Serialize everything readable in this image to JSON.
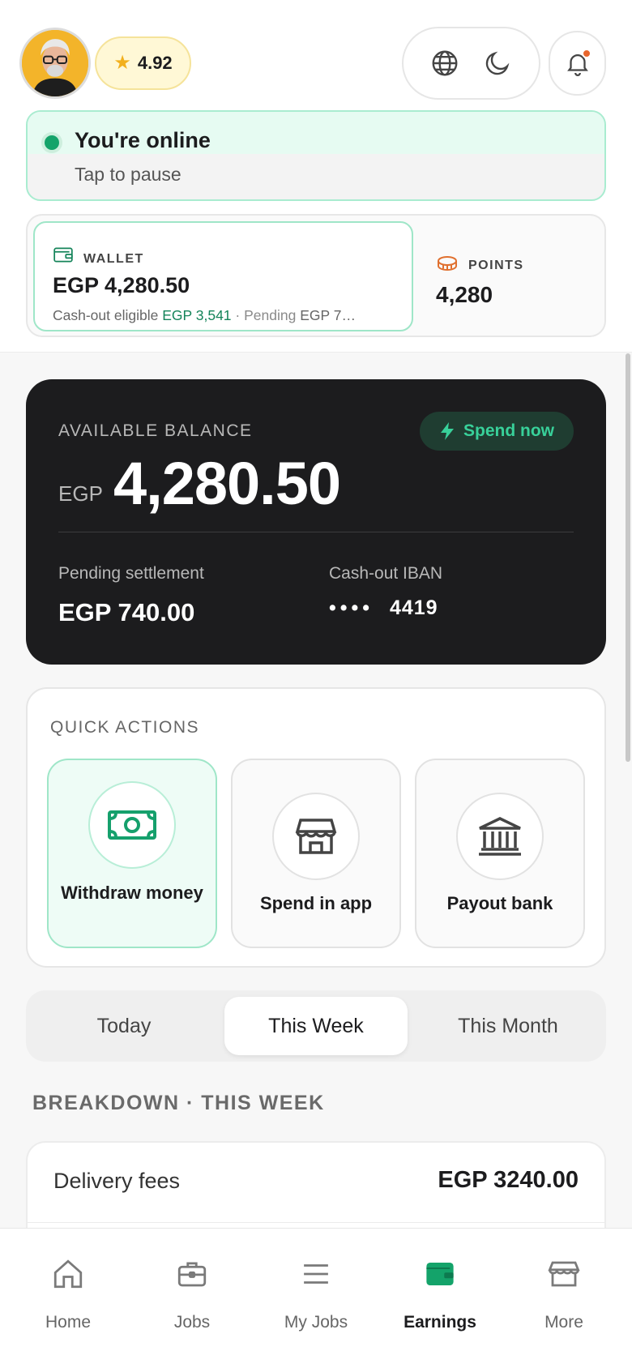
{
  "header": {
    "rating": "4.92",
    "colors": {
      "accent_green": "#14a36a",
      "notification_dot": "#e8662d",
      "star": "#f2b01e"
    },
    "icons": [
      "globe-icon",
      "moon-icon",
      "bell-icon"
    ]
  },
  "status": {
    "title": "You're online",
    "subtitle": "Tap to pause"
  },
  "wallet": {
    "label": "WALLET",
    "amount": "EGP 4,280.50",
    "cashout_prefix": "Cash-out eligible",
    "cashout_value": "EGP 3,541",
    "separator": "·",
    "pending_prefix": "Pending",
    "pending_value": "EGP 7…"
  },
  "points": {
    "label": "POINTS",
    "value": "4,280"
  },
  "balance": {
    "label": "AVAILABLE BALANCE",
    "spend_button": "Spend now",
    "currency": "EGP",
    "amount": "4,280.50",
    "pending_label": "Pending settlement",
    "pending_value": "EGP 740.00",
    "iban_label": "Cash-out IBAN",
    "iban_mask": "••••",
    "iban_last4": "4419"
  },
  "quick_actions": {
    "title": "QUICK ACTIONS",
    "items": [
      {
        "label": "Withdraw money",
        "icon": "cash-icon",
        "active": true
      },
      {
        "label": "Spend in app",
        "icon": "store-icon",
        "active": false
      },
      {
        "label": "Payout bank",
        "icon": "bank-icon",
        "active": false
      }
    ]
  },
  "periods": {
    "tabs": [
      "Today",
      "This Week",
      "This Month"
    ],
    "selected": "This Week"
  },
  "breakdown": {
    "title": "BREAKDOWN · THIS WEEK",
    "rows": [
      {
        "label": "Delivery fees",
        "value": "EGP 3240.00"
      }
    ]
  },
  "nav": {
    "items": [
      {
        "label": "Home",
        "icon": "home-icon"
      },
      {
        "label": "Jobs",
        "icon": "briefcase-icon"
      },
      {
        "label": "My Jobs",
        "icon": "list-icon"
      },
      {
        "label": "Earnings",
        "icon": "wallet-icon"
      },
      {
        "label": "More",
        "icon": "store-icon"
      }
    ],
    "active": "Earnings"
  }
}
